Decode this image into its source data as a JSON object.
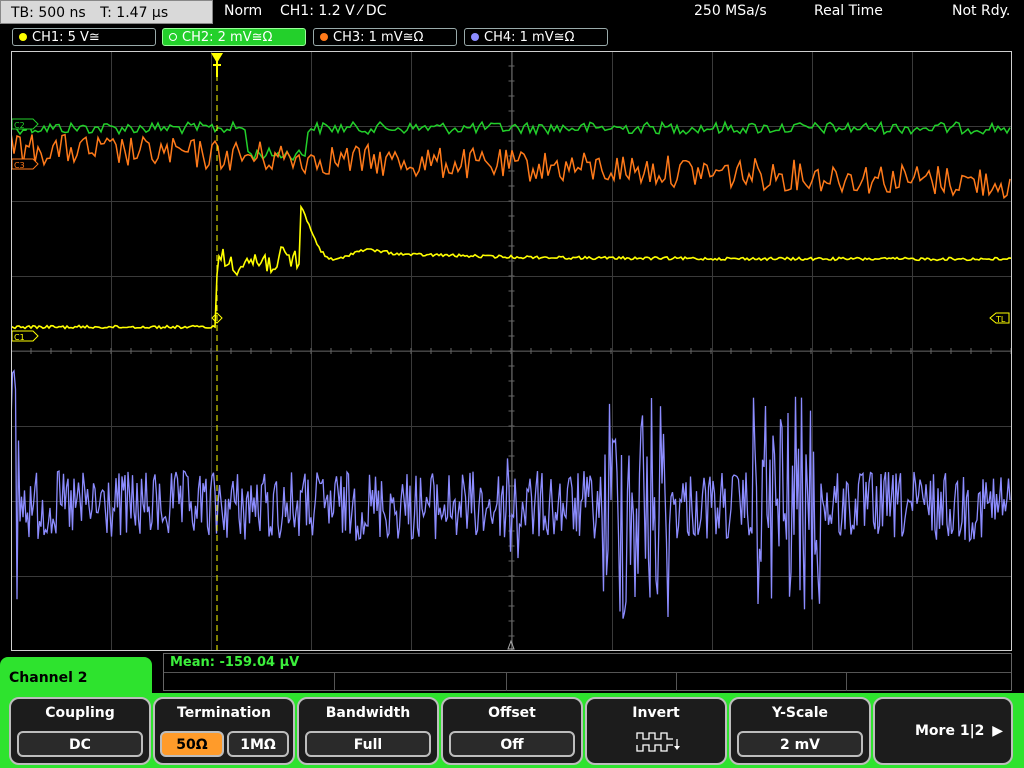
{
  "top": {
    "timebase": "TB: 500 ns",
    "trigger_time": "T: 1.47 µs",
    "mode": "Norm",
    "trigger_info": "CH1: 1.2 V ⁄ DC",
    "sample_rate": "250 MSa/s",
    "acq_mode": "Real Time",
    "status": "Not Rdy."
  },
  "channels": [
    {
      "label": "CH1: 5 V≅",
      "color": "#ffff00"
    },
    {
      "label": "CH2: 2 mV≅Ω",
      "color": "#23d02b"
    },
    {
      "label": "CH3: 1 mV≅Ω",
      "color": "#ff7a1a"
    },
    {
      "label": "CH4: 1 mV≅Ω",
      "color": "#8c8cff"
    }
  ],
  "markers": {
    "c1": "C1",
    "c2": "C2",
    "c3": "C3",
    "tl": "TL"
  },
  "measurement": {
    "text": "Mean: -159.04 µV"
  },
  "menu": {
    "title": "Channel 2",
    "coupling": {
      "title": "Coupling",
      "value": "DC"
    },
    "termination": {
      "title": "Termination",
      "opt1": "50Ω",
      "opt2": "1MΩ"
    },
    "bandwidth": {
      "title": "Bandwidth",
      "value": "Full"
    },
    "offset": {
      "title": "Offset",
      "value": "Off"
    },
    "invert": {
      "title": "Invert",
      "icon": "invert-waveform-icon"
    },
    "yscale": {
      "title": "Y-Scale",
      "value": "2 mV"
    },
    "more": {
      "label": "More 1|2"
    }
  }
}
